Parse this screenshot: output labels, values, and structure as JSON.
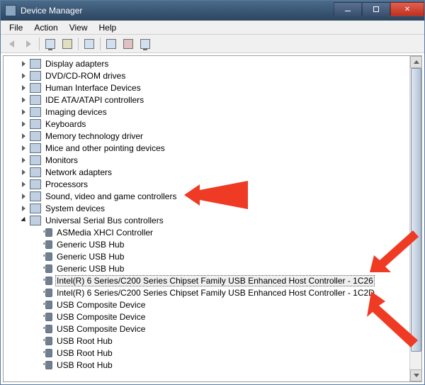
{
  "window": {
    "title": "Device Manager"
  },
  "menu": {
    "file": "File",
    "action": "Action",
    "view": "View",
    "help": "Help"
  },
  "tree": {
    "categories": [
      {
        "label": "Display adapters",
        "expanded": false
      },
      {
        "label": "DVD/CD-ROM drives",
        "expanded": false
      },
      {
        "label": "Human Interface Devices",
        "expanded": false
      },
      {
        "label": "IDE ATA/ATAPI controllers",
        "expanded": false
      },
      {
        "label": "Imaging devices",
        "expanded": false
      },
      {
        "label": "Keyboards",
        "expanded": false
      },
      {
        "label": "Memory technology driver",
        "expanded": false
      },
      {
        "label": "Mice and other pointing devices",
        "expanded": false
      },
      {
        "label": "Monitors",
        "expanded": false
      },
      {
        "label": "Network adapters",
        "expanded": false
      },
      {
        "label": "Processors",
        "expanded": false
      },
      {
        "label": "Sound, video and game controllers",
        "expanded": false
      },
      {
        "label": "System devices",
        "expanded": false
      },
      {
        "label": "Universal Serial Bus controllers",
        "expanded": true
      }
    ],
    "usb_children": [
      {
        "label": "ASMedia XHCI Controller",
        "selected": false
      },
      {
        "label": "Generic USB Hub",
        "selected": false
      },
      {
        "label": "Generic USB Hub",
        "selected": false
      },
      {
        "label": "Generic USB Hub",
        "selected": false
      },
      {
        "label": "Intel(R) 6 Series/C200 Series Chipset Family USB Enhanced Host Controller - 1C26",
        "selected": true
      },
      {
        "label": "Intel(R) 6 Series/C200 Series Chipset Family USB Enhanced Host Controller - 1C2D",
        "selected": false
      },
      {
        "label": "USB Composite Device",
        "selected": false
      },
      {
        "label": "USB Composite Device",
        "selected": false
      },
      {
        "label": "USB Composite Device",
        "selected": false
      },
      {
        "label": "USB Root Hub",
        "selected": false
      },
      {
        "label": "USB Root Hub",
        "selected": false
      },
      {
        "label": "USB Root Hub",
        "selected": false
      }
    ]
  },
  "annotations": {
    "color": "#ef3a24"
  }
}
